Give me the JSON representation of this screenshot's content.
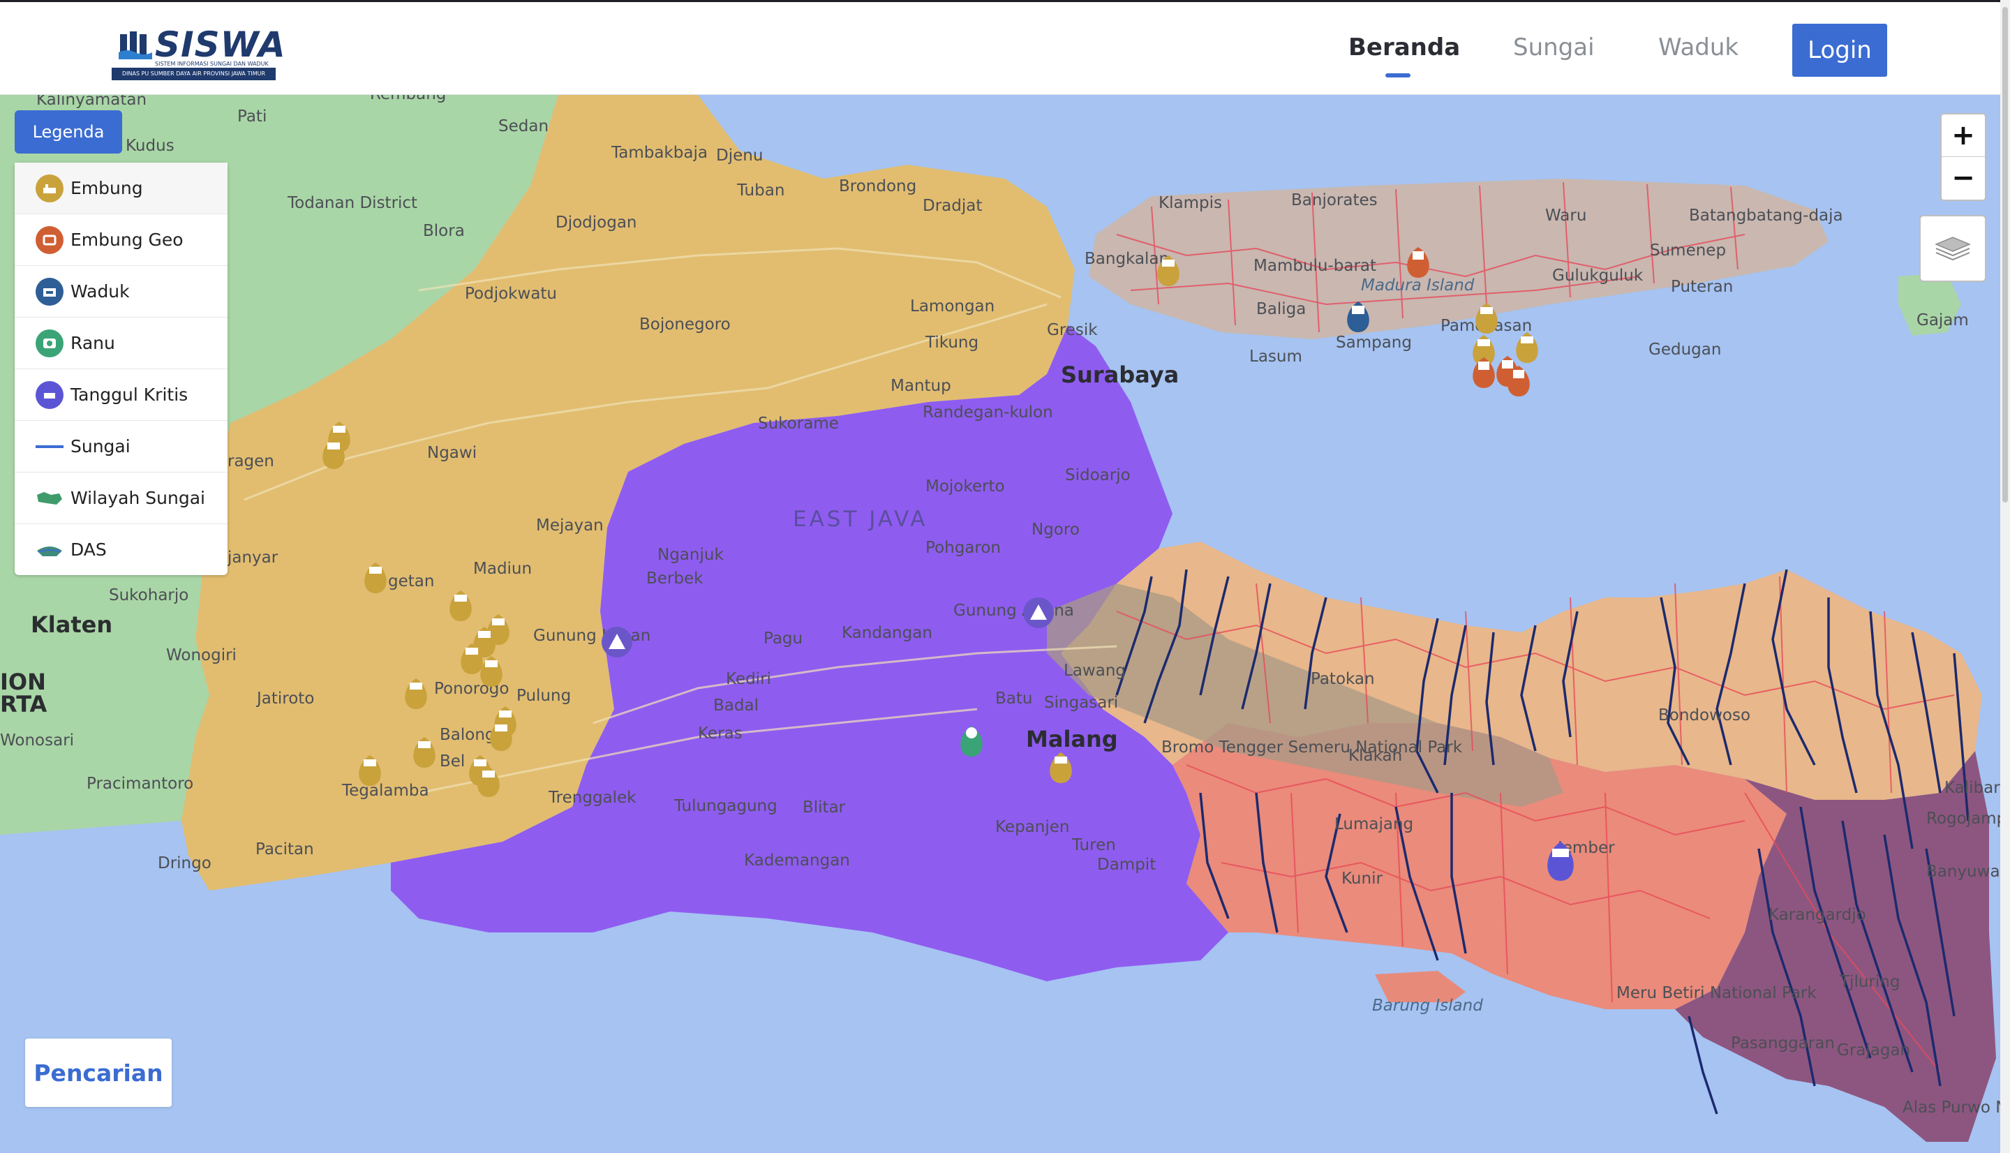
{
  "header": {
    "logo": {
      "name": "SISWA",
      "subtitle": "SISTEM INFORMASI SUNGAI DAN WADUK",
      "band": "DINAS PU SUMBER DAYA AIR PROVINSI JAWA TIMUR"
    },
    "nav": [
      {
        "label": "Beranda",
        "active": true
      },
      {
        "label": "Sungai",
        "active": false
      },
      {
        "label": "Waduk",
        "active": false
      }
    ],
    "login_label": "Login"
  },
  "legend": {
    "toggle_label": "Legenda",
    "items": [
      {
        "label": "Embung",
        "icon": "embung-icon",
        "color": "#c9a23c"
      },
      {
        "label": "Embung Geo",
        "icon": "embung-geo-icon",
        "color": "#cf5f33"
      },
      {
        "label": "Waduk",
        "icon": "waduk-icon",
        "color": "#2d5e96"
      },
      {
        "label": "Ranu",
        "icon": "ranu-icon",
        "color": "#3aa476"
      },
      {
        "label": "Tanggul Kritis",
        "icon": "tanggul-kritis-icon",
        "color": "#5b55d6"
      },
      {
        "label": "Sungai",
        "icon": "sungai-line-icon",
        "color": "#3b6cd2"
      },
      {
        "label": "Wilayah Sungai",
        "icon": "wilayah-sungai-icon",
        "color": "#3f9b6a"
      },
      {
        "label": "DAS",
        "icon": "das-icon",
        "color": "#3f8a7a"
      }
    ]
  },
  "map": {
    "zoom_in": "+",
    "zoom_out": "−",
    "region_colors": {
      "sea": "#a6c3f2",
      "land": "#a9d6a6",
      "west": "#e2bd70",
      "central": "#8f5cf0",
      "madura": "#c9b7b0",
      "east_north": "#e8b78b",
      "east_south": "#ea8b7b",
      "far_east": "#8d5680"
    },
    "labels": [
      {
        "text": "Kalinyamatan"
      },
      {
        "text": "Rembang"
      },
      {
        "text": "Pati"
      },
      {
        "text": "Sedan"
      },
      {
        "text": "Kudus"
      },
      {
        "text": "Tambakbaja"
      },
      {
        "text": "Djenu"
      },
      {
        "text": "Tuban"
      },
      {
        "text": "Brondong"
      },
      {
        "text": "Dradjat"
      },
      {
        "text": "Todanan District"
      },
      {
        "text": "Blora"
      },
      {
        "text": "Djodjogan"
      },
      {
        "text": "Podjokwatu"
      },
      {
        "text": "Bojonegoro"
      },
      {
        "text": "Lamongan"
      },
      {
        "text": "Tikung"
      },
      {
        "text": "Gresik"
      },
      {
        "text": "Surabaya"
      },
      {
        "text": "Mantup"
      },
      {
        "text": "Sukorame"
      },
      {
        "text": "Randegan-kulon"
      },
      {
        "text": "Ngawi"
      },
      {
        "text": "ragen"
      },
      {
        "text": "Mojokerto"
      },
      {
        "text": "Sidoarjo"
      },
      {
        "text": "Mejayan"
      },
      {
        "text": "EAST JAVA"
      },
      {
        "text": "Ngoro"
      },
      {
        "text": "Nganjuk"
      },
      {
        "text": "Pohgaron"
      },
      {
        "text": "Berbek"
      },
      {
        "text": "janyar"
      },
      {
        "text": "Madiun"
      },
      {
        "text": "Sukoharjo"
      },
      {
        "text": "getan"
      },
      {
        "text": "Klaten"
      },
      {
        "text": "Gunung Liman"
      },
      {
        "text": "Pagu"
      },
      {
        "text": "Kandangan"
      },
      {
        "text": "Gunung Arjuna"
      },
      {
        "text": "Wonogiri"
      },
      {
        "text": "Ponorogo"
      },
      {
        "text": "Pulung"
      },
      {
        "text": "Kediri"
      },
      {
        "text": "Badal"
      },
      {
        "text": "Batu"
      },
      {
        "text": "Singasari"
      },
      {
        "text": "Lawang"
      },
      {
        "text": "Jatiroto"
      },
      {
        "text": "ION"
      },
      {
        "text": "RTA"
      },
      {
        "text": "Keras"
      },
      {
        "text": "Malang"
      },
      {
        "text": "Balong"
      },
      {
        "text": "Wonosari"
      },
      {
        "text": "Bel"
      },
      {
        "text": "Pracimantoro"
      },
      {
        "text": "Tegalamba"
      },
      {
        "text": "Trenggalek"
      },
      {
        "text": "Tulungagung"
      },
      {
        "text": "Blitar"
      },
      {
        "text": "Kepanjen"
      },
      {
        "text": "Turen"
      },
      {
        "text": "Pacitan"
      },
      {
        "text": "Kademangan"
      },
      {
        "text": "Dampit"
      },
      {
        "text": "Dringo"
      },
      {
        "text": "Klampis"
      },
      {
        "text": "Banjorates"
      },
      {
        "text": "Waru"
      },
      {
        "text": "Batangbatang-daja"
      },
      {
        "text": "Bangkalan"
      },
      {
        "text": "Mambulu-barat"
      },
      {
        "text": "Madura Island"
      },
      {
        "text": "Sumenep"
      },
      {
        "text": "Gulukguluk"
      },
      {
        "text": "Puteran"
      },
      {
        "text": "Baliga"
      },
      {
        "text": "Sampang"
      },
      {
        "text": "Pamekasan"
      },
      {
        "text": "Gedugan"
      },
      {
        "text": "Gajam"
      },
      {
        "text": "Lasum"
      },
      {
        "text": "Patokan"
      },
      {
        "text": "Bondowoso"
      },
      {
        "text": "Klakah"
      },
      {
        "text": "Bromo Tengger Semeru National Park"
      },
      {
        "text": "Lumajang"
      },
      {
        "text": "Kunir"
      },
      {
        "text": "Jember"
      },
      {
        "text": "Rogojampi"
      },
      {
        "text": "Kalibaru"
      },
      {
        "text": "Banyuwangi"
      },
      {
        "text": "Karangardjo"
      },
      {
        "text": "Tjluring"
      },
      {
        "text": "Meru Betiri National Park"
      },
      {
        "text": "Pasanggaran"
      },
      {
        "text": "Grajagan"
      },
      {
        "text": "Barung Island"
      },
      {
        "text": "Alas Purwo National Park"
      }
    ]
  },
  "search_label": "Pencarian"
}
